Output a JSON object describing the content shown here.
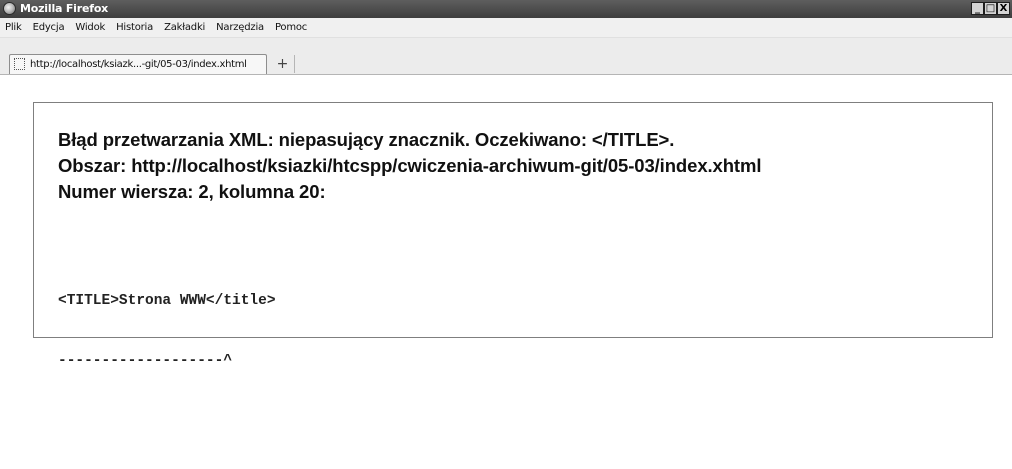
{
  "window": {
    "title": "Mozilla Firefox",
    "controls": {
      "minimize": "_",
      "maximize": "□",
      "close": "X"
    }
  },
  "menu": {
    "items": [
      "Plik",
      "Edycja",
      "Widok",
      "Historia",
      "Zakładki",
      "Narzędzia",
      "Pomoc"
    ]
  },
  "tab": {
    "title": "http://localhost/ksiazk...-git/05-03/index.xhtml",
    "new_tab_symbol": "+"
  },
  "error": {
    "message": "Błąd przetwarzania XML: niepasujący znacznik. Oczekiwano: </TITLE>.",
    "location": "Obszar: http://localhost/ksiazki/htcspp/cwiczenia-archiwum-git/05-03/index.xhtml",
    "line_info": "Numer wiersza: 2, kolumna 20:",
    "source_line": "<TITLE>Strona WWW</title>",
    "pointer_line": "-------------------^"
  }
}
